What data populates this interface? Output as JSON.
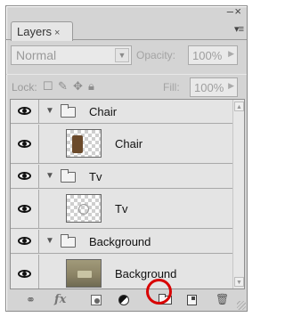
{
  "window": {
    "minimize_glyph": "–",
    "close_glyph": "×"
  },
  "tabs": [
    {
      "label": "Layers",
      "close": "×"
    }
  ],
  "panel_menu_glyph": "▾≡",
  "blend": {
    "mode": "Normal",
    "opacity_label": "Opacity:",
    "opacity_value": "100%"
  },
  "lock": {
    "label": "Lock:",
    "fill_label": "Fill:",
    "fill_value": "100%"
  },
  "layers": [
    {
      "type": "group",
      "name": "Chair",
      "visible": true,
      "expanded": true
    },
    {
      "type": "layer",
      "name": "Chair",
      "visible": true,
      "thumbnail": "chair"
    },
    {
      "type": "group",
      "name": "Tv",
      "visible": true,
      "expanded": true
    },
    {
      "type": "layer",
      "name": "Tv",
      "visible": true,
      "thumbnail": "tv"
    },
    {
      "type": "group",
      "name": "Background",
      "visible": true,
      "expanded": true
    },
    {
      "type": "layer",
      "name": "Background",
      "visible": true,
      "thumbnail": "background"
    }
  ],
  "bottom_toolbar": {
    "fx_label": "fx",
    "highlighted_button": "new-group-button",
    "highlight_color": "#d80000"
  },
  "icons": {
    "link": "link-icon",
    "fx": "fx-icon",
    "mask": "mask-icon",
    "adjustment": "adjustment-layer-icon",
    "new_group": "folder-icon",
    "new_layer": "new-layer-icon",
    "delete": "trash-icon"
  }
}
